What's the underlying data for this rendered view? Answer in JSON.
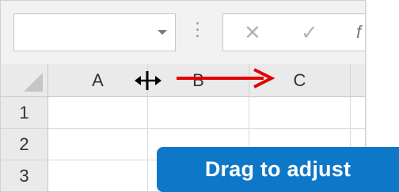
{
  "formula_bar": {
    "name_box_value": "",
    "cancel_icon": "x-icon",
    "enter_icon": "check-icon",
    "fx_label": "f"
  },
  "columns": [
    "A",
    "B",
    "C"
  ],
  "rows": [
    "1",
    "2",
    "3"
  ],
  "cursor": "column-resize-cursor",
  "callout": {
    "text": "Drag to adjust",
    "color": "#0f77c8"
  },
  "arrow_color": "#e30000"
}
